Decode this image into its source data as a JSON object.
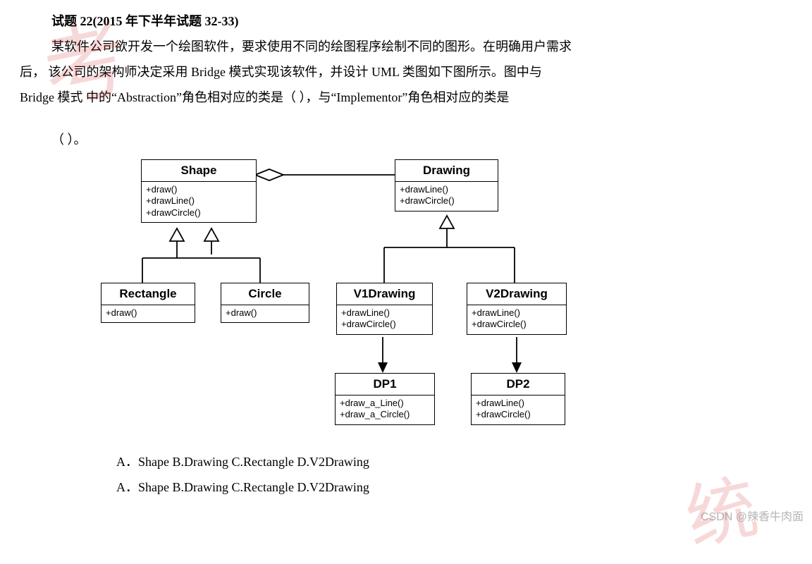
{
  "question": {
    "title": "试题 22(2015 年下半年试题 32-33)",
    "para1": "某软件公司欲开发一个绘图软件，要求使用不同的绘图程序绘制不同的图形。在明确用户需求",
    "para2": "后，  该公司的架构师决定采用 Bridge 模式实现该软件，并设计 UML 类图如下图所示。图中与",
    "para3": "Bridge 模式 中的“Abstraction”角色相对应的类是（ ），与“Implementor”角色相对应的类是",
    "para4": "（ ）。",
    "options1": "A．Shape   B.Drawing C.Rectangle D.V2Drawing",
    "options2": "A．Shape  B.Drawing C.Rectangle D.V2Drawing"
  },
  "uml": {
    "Shape": {
      "name": "Shape",
      "ops": [
        "+draw()",
        "+drawLine()",
        "+drawCircle()"
      ]
    },
    "Drawing": {
      "name": "Drawing",
      "ops": [
        "+drawLine()",
        "+drawCircle()"
      ]
    },
    "Rectangle": {
      "name": "Rectangle",
      "ops": [
        "+draw()"
      ]
    },
    "Circle": {
      "name": "Circle",
      "ops": [
        "+draw()"
      ]
    },
    "V1Drawing": {
      "name": "V1Drawing",
      "ops": [
        "+drawLine()",
        "+drawCircle()"
      ]
    },
    "V2Drawing": {
      "name": "V2Drawing",
      "ops": [
        "+drawLine()",
        "+drawCircle()"
      ]
    },
    "DP1": {
      "name": "DP1",
      "ops": [
        "+draw_a_Line()",
        "+draw_a_Circle()"
      ]
    },
    "DP2": {
      "name": "DP2",
      "ops": [
        "+drawLine()",
        "+drawCircle()"
      ]
    }
  },
  "csdn": "CSDN @辣香牛肉面"
}
